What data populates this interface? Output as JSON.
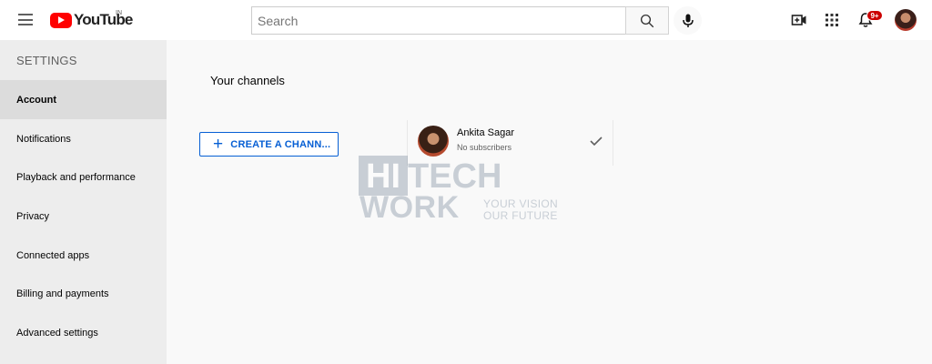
{
  "header": {
    "logo_text": "YouTube",
    "country_code": "IN",
    "search_placeholder": "Search",
    "notification_count": "9+",
    "icons": [
      "menu-icon",
      "search-icon",
      "microphone-icon",
      "create-video-icon",
      "apps-grid-icon",
      "notification-bell-icon"
    ]
  },
  "sidebar": {
    "title": "SETTINGS",
    "items": [
      {
        "label": "Account",
        "active": true
      },
      {
        "label": "Notifications",
        "active": false
      },
      {
        "label": "Playback and performance",
        "active": false
      },
      {
        "label": "Privacy",
        "active": false
      },
      {
        "label": "Connected apps",
        "active": false
      },
      {
        "label": "Billing and payments",
        "active": false
      },
      {
        "label": "Advanced settings",
        "active": false
      }
    ]
  },
  "main": {
    "title": "Your channels",
    "create_channel_label": "CREATE A CHANN...",
    "channel": {
      "name": "Ankita Sagar",
      "subscribers": "No subscribers",
      "selected_icon": "check-icon"
    }
  },
  "watermark": {
    "brand_top_left": "HI",
    "brand_top_right": "TECH",
    "brand_bottom": "WORK",
    "tagline_line1": "YOUR VISION",
    "tagline_line2": "OUR FUTURE"
  },
  "colors": {
    "brand_red": "#FF0000",
    "link_blue": "#065FD4",
    "badge_red": "#CC0000",
    "sidebar_bg": "#EDEDED",
    "active_item_bg": "#DCDCDC"
  }
}
